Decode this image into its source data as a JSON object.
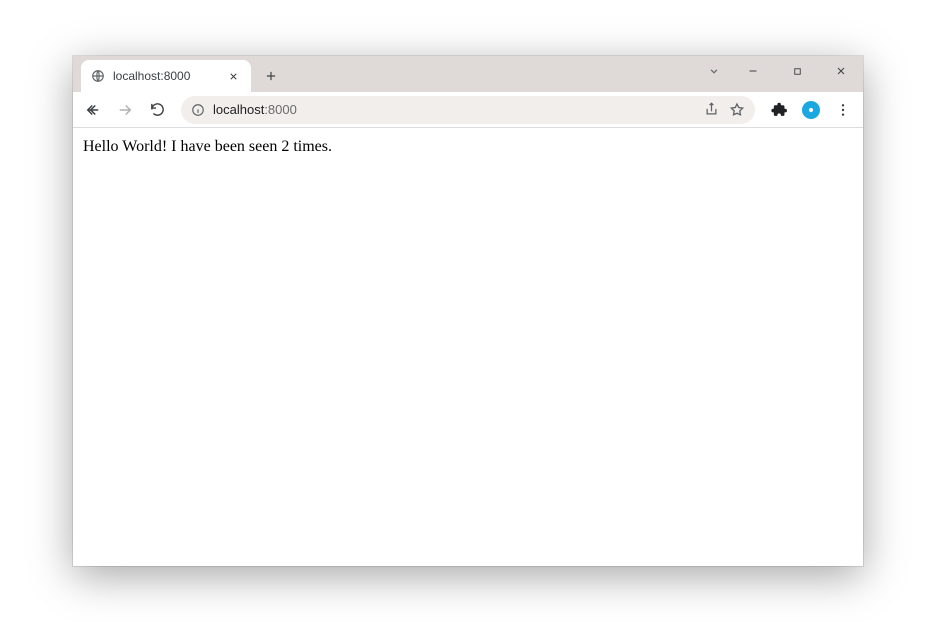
{
  "window": {
    "tab": {
      "title": "localhost:8000"
    }
  },
  "addressbar": {
    "host": "localhost",
    "port": ":8000"
  },
  "page": {
    "body_text": "Hello World! I have been seen 2 times."
  }
}
